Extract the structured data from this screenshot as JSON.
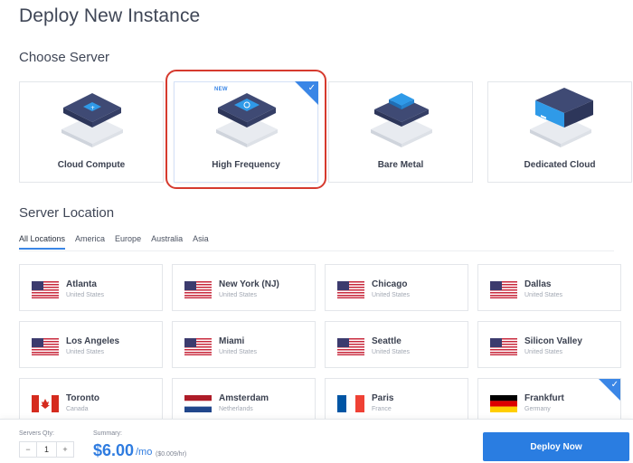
{
  "page": {
    "title": "Deploy New Instance"
  },
  "sections": {
    "choose_server": "Choose Server",
    "server_location": "Server Location"
  },
  "servers": [
    {
      "label": "Cloud Compute",
      "selected": false
    },
    {
      "label": "High Frequency",
      "selected": true,
      "badge": "NEW"
    },
    {
      "label": "Bare Metal",
      "selected": false
    },
    {
      "label": "Dedicated Cloud",
      "selected": false
    }
  ],
  "location_tabs": [
    {
      "label": "All Locations",
      "active": true
    },
    {
      "label": "America",
      "active": false
    },
    {
      "label": "Europe",
      "active": false
    },
    {
      "label": "Australia",
      "active": false
    },
    {
      "label": "Asia",
      "active": false
    }
  ],
  "locations": [
    {
      "city": "Atlanta",
      "country": "United States",
      "flag": "us-flag-icon",
      "selected": false
    },
    {
      "city": "New York (NJ)",
      "country": "United States",
      "flag": "us-flag-icon",
      "selected": false
    },
    {
      "city": "Chicago",
      "country": "United States",
      "flag": "us-flag-icon",
      "selected": false
    },
    {
      "city": "Dallas",
      "country": "United States",
      "flag": "us-flag-icon",
      "selected": false
    },
    {
      "city": "Los Angeles",
      "country": "United States",
      "flag": "us-flag-icon",
      "selected": false
    },
    {
      "city": "Miami",
      "country": "United States",
      "flag": "us-flag-icon",
      "selected": false
    },
    {
      "city": "Seattle",
      "country": "United States",
      "flag": "us-flag-icon",
      "selected": false
    },
    {
      "city": "Silicon Valley",
      "country": "United States",
      "flag": "us-flag-icon",
      "selected": false
    },
    {
      "city": "Toronto",
      "country": "Canada",
      "flag": "canada-flag-icon",
      "selected": false
    },
    {
      "city": "Amsterdam",
      "country": "Netherlands",
      "flag": "netherlands-flag-icon",
      "selected": false
    },
    {
      "city": "Paris",
      "country": "France",
      "flag": "france-flag-icon",
      "selected": false
    },
    {
      "city": "Frankfurt",
      "country": "Germany",
      "flag": "germany-flag-icon",
      "selected": true
    }
  ],
  "footer": {
    "qty_label": "Servers Qty:",
    "qty_minus": "−",
    "qty_value": "1",
    "qty_plus": "+",
    "summary_label": "Summary:",
    "price": "$6.00",
    "per": "/mo",
    "hourly": "($0.009/hr)",
    "deploy_label": "Deploy Now"
  },
  "colors": {
    "accent": "#2a7de1",
    "highlight": "#d63a2e"
  }
}
